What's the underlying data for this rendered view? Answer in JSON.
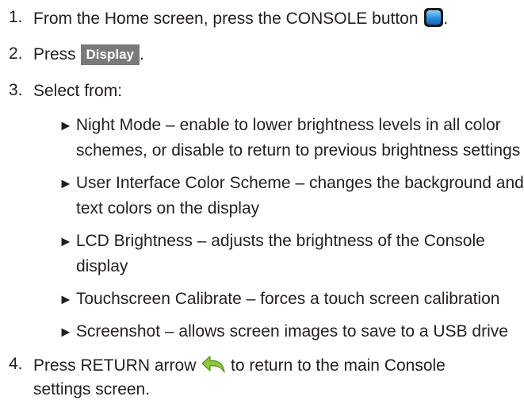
{
  "steps": [
    {
      "number": "1.",
      "text_before": "From the Home screen, press the CONSOLE button",
      "text_after": "."
    },
    {
      "number": "2.",
      "text_before": "Press",
      "button": "Display",
      "text_after": "."
    },
    {
      "number": "3.",
      "text": "Select from:"
    },
    {
      "number": "4.",
      "text_before": "Press RETURN arrow",
      "text_after": "to return to the main Console",
      "text_cont": "settings screen."
    }
  ],
  "options": [
    {
      "line1": "Night Mode – enable to lower brightness levels in all color",
      "line2": "schemes, or disable to return to previous brightness settings"
    },
    {
      "line1": "User Interface Color Scheme – changes the background and",
      "line2": "text colors on the display"
    },
    {
      "line1": "LCD Brightness – adjusts the brightness of the Console",
      "line2": "display"
    },
    {
      "line1": "Touchscreen Calibrate – forces a touch screen calibration"
    },
    {
      "line1": "Screenshot – allows screen images to save to a USB drive"
    }
  ],
  "bullet_glyph": "►",
  "icons": {
    "console": "console-button-icon",
    "return": "return-arrow-icon"
  },
  "colors": {
    "text": "#231f20",
    "button_bg": "#7a7a7a",
    "return_arrow": "#8dc63f"
  }
}
